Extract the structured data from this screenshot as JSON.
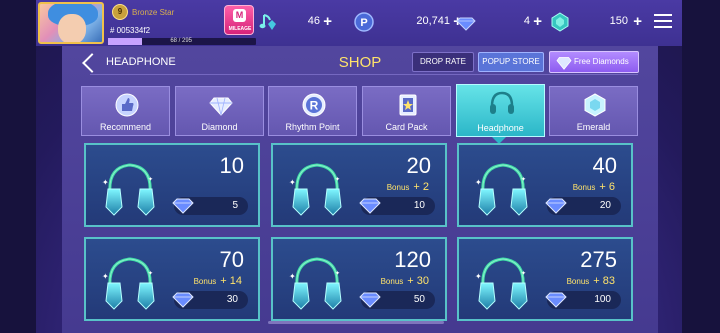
{
  "profile": {
    "rank_level": "9",
    "rank_name": "Bronze Star",
    "player_id": "# 005334f2",
    "xp_text": "68 / 295",
    "xp_progress": 0.23,
    "mileage_label": "MILEAGE",
    "mileage_icon_text": "M"
  },
  "currencies": [
    {
      "icon": "music-note-gem-icon",
      "value": "46"
    },
    {
      "icon": "rhythm-point-icon",
      "value": "20,741"
    },
    {
      "icon": "diamond-icon",
      "value": "4"
    },
    {
      "icon": "emerald-icon",
      "value": "150"
    }
  ],
  "header": {
    "breadcrumb": "HEADPHONE",
    "title": "SHOP",
    "drop_rate": "DROP RATE",
    "popup_store": "POPUP STORE",
    "free_diamonds": "Free Diamonds"
  },
  "tabs": [
    {
      "label": "Recommend",
      "icon": "thumbs-up-icon",
      "active": false
    },
    {
      "label": "Diamond",
      "icon": "diamond-icon",
      "active": false
    },
    {
      "label": "Rhythm Point",
      "icon": "rhythm-point-icon",
      "active": false
    },
    {
      "label": "Card Pack",
      "icon": "card-pack-icon",
      "active": false
    },
    {
      "label": "Headphone",
      "icon": "headphone-icon",
      "active": true
    },
    {
      "label": "Emerald",
      "icon": "emerald-icon",
      "active": false
    }
  ],
  "items": [
    {
      "amount": "10",
      "bonus_label": "",
      "bonus": "",
      "price": "5"
    },
    {
      "amount": "20",
      "bonus_label": "Bonus",
      "bonus": "+ 2",
      "price": "10"
    },
    {
      "amount": "40",
      "bonus_label": "Bonus",
      "bonus": "+ 6",
      "price": "20"
    },
    {
      "amount": "70",
      "bonus_label": "Bonus",
      "bonus": "+ 14",
      "price": "30"
    },
    {
      "amount": "120",
      "bonus_label": "Bonus",
      "bonus": "+ 30",
      "price": "50"
    },
    {
      "amount": "275",
      "bonus_label": "Bonus",
      "bonus": "+ 83",
      "price": "100"
    }
  ],
  "colors": {
    "accent_cyan": "#58c2c8",
    "gold": "#ffe36b",
    "panel": "#453a90"
  }
}
